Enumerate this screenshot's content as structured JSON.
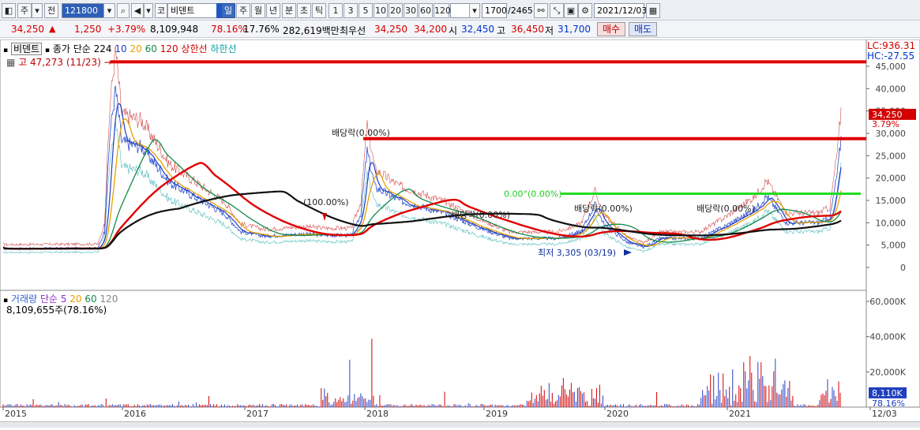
{
  "toolbar": {
    "jeon": "전",
    "ju": "주",
    "code": "121800",
    "ko": "코",
    "name": "비덴트",
    "periods": [
      "일",
      "주",
      "월",
      "년",
      "분",
      "초",
      "틱"
    ],
    "intervals": [
      "1",
      "3",
      "5",
      "10",
      "20",
      "30",
      "60",
      "120"
    ],
    "count": "1700",
    "total": "/2465",
    "date": "2021/12/03"
  },
  "quote": {
    "price": "34,250",
    "change": "1,250",
    "change_pct": "+3.79%",
    "volume": "8,109,948",
    "vol_ratio": "78.16%",
    "turnover": "17.76%",
    "amount": "282,619백만",
    "best_label": "최우선",
    "best_sell": "34,250",
    "best_buy": "34,200",
    "open_label": "시",
    "open": "32,450",
    "high_label": "고",
    "high": "36,450",
    "low_label": "저",
    "low": "31,700",
    "buy_btn": "매수",
    "sell_btn": "매도"
  },
  "price_legend": {
    "tag": "비덴트",
    "desc": "종가 단순 224",
    "ma10": "10",
    "ma20": "20",
    "ma60": "60",
    "ma120": "120",
    "upper": "상한선",
    "lower": "하한선",
    "high_marker": "고 47,273 (11/23)",
    "lc": "LC:936.31",
    "hc": "HC:-27.55"
  },
  "annotations": {
    "div1": "배당락(0.00%)",
    "div_100": "(100.00%)",
    "div2": "배당락(0.00%)",
    "div3": "배당락(0.00%)",
    "div4": "배당락(0.00%)",
    "green_line": "0.00°(0.00%)",
    "low_marker": "최저 3,305 (03/19)",
    "price_tag": "34,250",
    "price_pct": "3.79%"
  },
  "price_axis": [
    "45,000",
    "40,000",
    "35,000",
    "30,000",
    "25,000",
    "20,000",
    "15,000",
    "10,000",
    "5,000",
    "0"
  ],
  "volume_legend": {
    "desc": "거래량",
    "ma_desc": "단순",
    "ma5": "5",
    "ma20": "20",
    "ma60": "60",
    "ma120": "120",
    "value": "8,109,655주(78.16%)"
  },
  "volume_axis": [
    "60,000K",
    "40,000K",
    "20,000K"
  ],
  "volume_tag": "8,110K",
  "volume_pct": "78.16%",
  "x_axis": [
    "2015",
    "2016",
    "2017",
    "2018",
    "2019",
    "2020",
    "2021",
    "12/03"
  ],
  "colors": {
    "red": "#e00000",
    "blue": "#1f3fbf",
    "ma20": "#e8a000",
    "ma60": "#128a4a",
    "ma120_black": "#111111",
    "green_line": "#22dd22"
  }
}
